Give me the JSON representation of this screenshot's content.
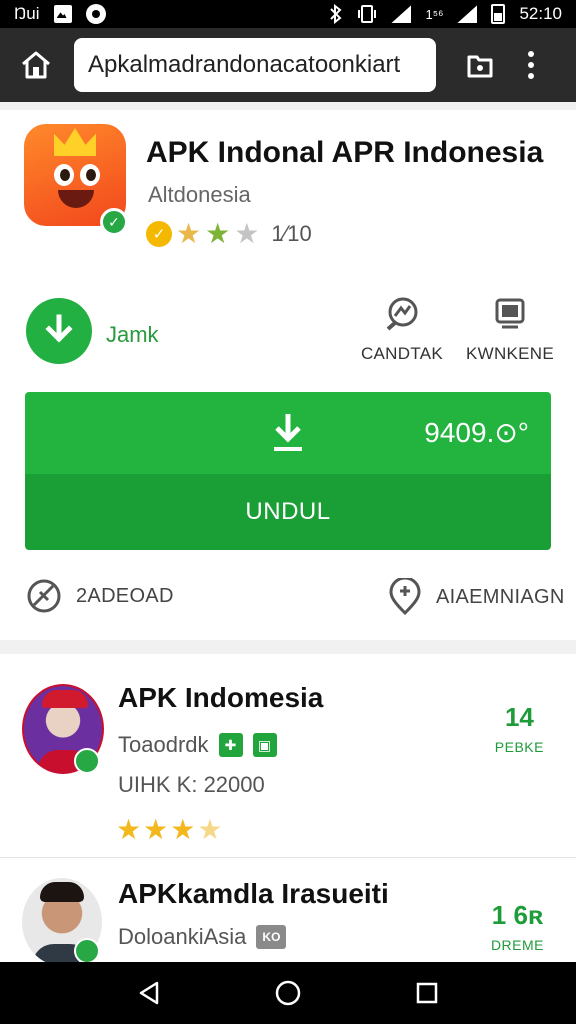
{
  "status_bar": {
    "left_text": "Ŋui",
    "network_text": "1⁵⁶",
    "time": "52:10",
    "icons": [
      "image-icon",
      "circle-icon",
      "bluetooth-icon",
      "vibrate-icon",
      "signal-icon",
      "signal-icon",
      "battery-icon"
    ]
  },
  "browser": {
    "url": "Apkalmadrandonacatoonkiart",
    "icons": [
      "home-icon",
      "tab-icon",
      "more-vert-icon"
    ]
  },
  "app": {
    "title": "APK Indonal APR Indonesia",
    "subtitle": "Altdonesia",
    "rating_badge": "✓",
    "rating_count": "1⁄10",
    "download_label": "Jamk",
    "actions": [
      {
        "label": "CANDTAK",
        "icon": "chart-badge-icon"
      },
      {
        "label": "KWNKENE",
        "icon": "device-icon"
      }
    ],
    "size_text": "9409.⊙°",
    "button_label": "UNDUL",
    "info_left": "2ADEOAD",
    "info_right": "AIAEMNIAGN",
    "colors": {
      "accent": "#23b43f",
      "accent_dark": "#1a9f37"
    }
  },
  "list": [
    {
      "title": "APK Indomesia",
      "subtitle": "Toaodrdk",
      "detail": "UIHK K: 22000",
      "right_number": "14",
      "right_label": "PEBKE",
      "stars": 4
    },
    {
      "title": "APKkamdla Irasueiti",
      "subtitle": "DoloankiAsia",
      "tag": "KO",
      "right_number": "1 6ʀ",
      "right_label": "DREME"
    }
  ],
  "nav": {
    "icons": [
      "back-icon",
      "home-circle-icon",
      "recents-icon"
    ]
  }
}
